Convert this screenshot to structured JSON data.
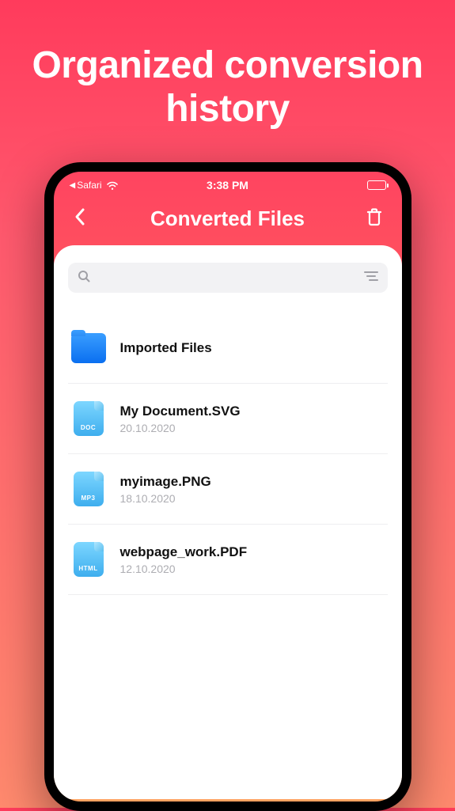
{
  "promo": {
    "title": "Organized conversion history"
  },
  "statusBar": {
    "backApp": "Safari",
    "time": "3:38 PM"
  },
  "nav": {
    "title": "Converted Files"
  },
  "search": {
    "placeholder": ""
  },
  "folder": {
    "title": "Imported Files"
  },
  "files": [
    {
      "title": "My Document.SVG",
      "date": "20.10.2020",
      "type": "DOC"
    },
    {
      "title": "myimage.PNG",
      "date": "18.10.2020",
      "type": "MP3"
    },
    {
      "title": "webpage_work.PDF",
      "date": "12.10.2020",
      "type": "HTML"
    }
  ]
}
